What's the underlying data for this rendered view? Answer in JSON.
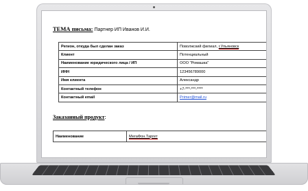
{
  "email": {
    "subject_label": "ТЕМА письма:",
    "subject_text": "Партнер ИП Иванов И.И.",
    "rows": [
      {
        "key": "Регион, откуда был сделан заказ",
        "value_prefix": "Поволжский филиал, ",
        "value_link": "г.Ульяновск"
      },
      {
        "key": "Клиент",
        "value": "Потенциальный"
      },
      {
        "key": "Наименование юридического лица / ИП",
        "value": "ООО \"Ромашка\""
      },
      {
        "key": "ИНН",
        "value": "123456789000"
      },
      {
        "key": "Имя клиента",
        "value": "Александр"
      },
      {
        "key": "Контактный телефон",
        "value": "+7-***-***-****"
      },
      {
        "key": "Контактный email",
        "value": "Primer@mail.ru"
      }
    ],
    "product_heading": "Заказанный продукт",
    "product_heading_colon": ":",
    "product_key": "Наименование",
    "product_value": "МегаФон.Таргет"
  }
}
